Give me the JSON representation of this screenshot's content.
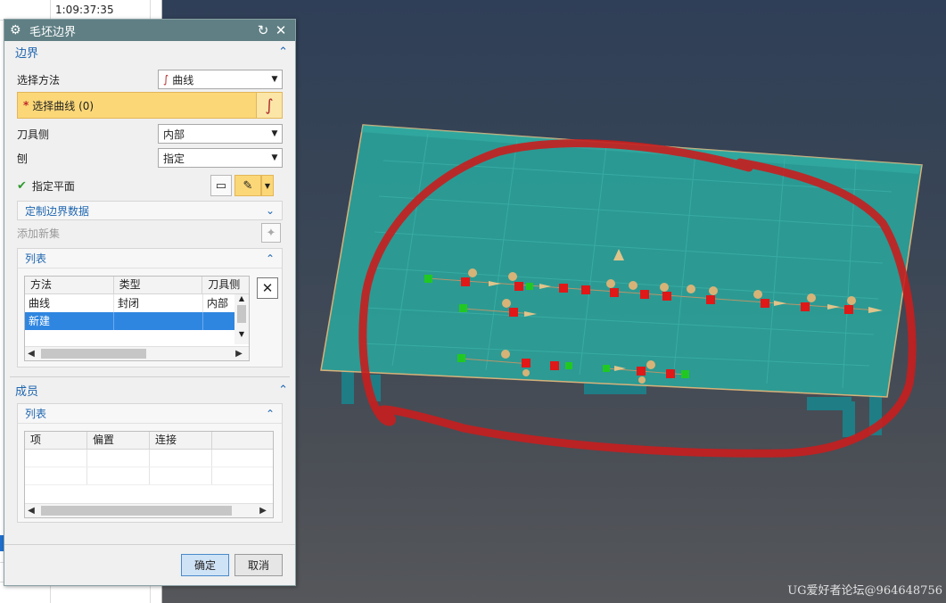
{
  "background_sheet": {
    "time_cell": "1:09:37:35"
  },
  "dialog": {
    "title": "毛坯边界",
    "boundary_section": {
      "title": "边界",
      "select_method_label": "选择方法",
      "select_method_value": "曲线",
      "select_curve_label": "选择曲线 (0)",
      "tool_side_label": "刀具侧",
      "tool_side_value": "内部",
      "plane_label": "刨",
      "plane_value": "指定",
      "specify_plane_label": "指定平面",
      "custom_boundary_label": "定制边界数据",
      "add_new_set_label": "添加新集",
      "list": {
        "title": "列表",
        "columns": [
          "方法",
          "类型",
          "刀具侧"
        ],
        "rows": [
          [
            "曲线",
            "封闭",
            "内部"
          ],
          [
            "新建",
            "",
            ""
          ]
        ]
      }
    },
    "members_section": {
      "title": "成员",
      "list": {
        "title": "列表",
        "columns": [
          "项",
          "偏置",
          "连接"
        ]
      }
    },
    "ok_label": "确定",
    "cancel_label": "取消"
  },
  "watermark": "UG爱好者论坛@964648756",
  "colors": {
    "title_bar": "#5f7f84",
    "selection_highlight": "#fbd777",
    "plate": "#2aa59c",
    "annotation_circle": "#c81e1e"
  }
}
